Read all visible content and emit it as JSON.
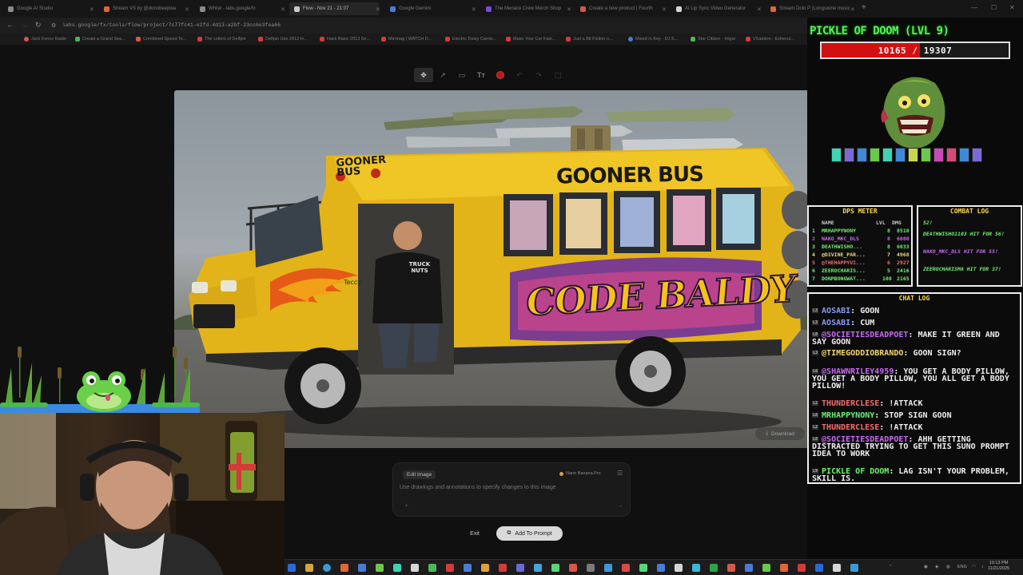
{
  "browser": {
    "tabs": [
      {
        "title": "Google AI Studio",
        "color": "#8a8a8a"
      },
      {
        "title": "Stream VS by @donobeepwa",
        "color": "#e0653a"
      },
      {
        "title": "Whisk - labs.google/fx",
        "color": "#8a8a8a"
      },
      {
        "title": "Flow - Nov 21 - 21:07",
        "color": "#6a6a6a",
        "active": true
      },
      {
        "title": "Google Gemini",
        "color": "#4a7cd6"
      },
      {
        "title": "The Menace Crew Merch Shop",
        "color": "#7a4ad6"
      },
      {
        "title": "Create a new product | Fourth",
        "color": "#d6584a"
      },
      {
        "title": "AI Lip Sync Video Generator",
        "color": "#d6d6d6"
      },
      {
        "title": "Stream Dolo P (Longswine music",
        "color": "#e0653a"
      }
    ],
    "url": "labs.google/fx/tools/flow/project/7c77fc41-e2fd-4d13-a2bf-23cc6e3fea66",
    "bookmarks": [
      {
        "label": "Jack Fence Radio",
        "color": "#d6584a"
      },
      {
        "label": "Create a Grand Sea...",
        "color": "#4ab85a"
      },
      {
        "label": "Combined Speed Te...",
        "color": "#d6584a"
      },
      {
        "label": "The coilers of Delfpin",
        "color": "#d63a3a"
      },
      {
        "label": "Delfpin Use 2013 H...",
        "color": "#d63a3a"
      },
      {
        "label": "Hack Basic 2013 Se...",
        "color": "#d63a3a"
      },
      {
        "label": "Mirrmag | WATCH D...",
        "color": "#d63a3a"
      },
      {
        "label": "Electric Daisy Carniv...",
        "color": "#d63a3a"
      },
      {
        "label": "Make Your Car Fast...",
        "color": "#d63a3a"
      },
      {
        "label": "Just a Bit Fiction o...",
        "color": "#d63a3a"
      },
      {
        "label": "Mixed In Key - DJ S...",
        "color": "#4a7cd6"
      },
      {
        "label": "Star Citizen - Imgur",
        "color": "#4ab85a"
      },
      {
        "label": "VSaddon - Eshecut...",
        "color": "#d63a3a"
      }
    ]
  },
  "flow": {
    "image_watermark": "Teccy",
    "download_label": "Download",
    "edit_panel": {
      "title": "Edit Image",
      "model": "Nano Banana Pro",
      "placeholder": "Use drawings and annotations to specify changes to this image"
    },
    "exit_label": "Exit",
    "add_to_prompt_label": "Add To Prompt"
  },
  "bus": {
    "roof_sign": "GOONER BUS",
    "side_title": "GOONER BUS",
    "graffiti": "CODE BALDY",
    "shirt_text": "TRUCK NUTS"
  },
  "boss": {
    "name": "PICKLE OF DOOM (LVL 9)",
    "hp_current": "10165",
    "hp_max": "19307",
    "hp_fraction": 0.527,
    "palette": [
      "#3fd2b4",
      "#7a6ad6",
      "#3f8ad6",
      "#6ac84a",
      "#3fd2b4",
      "#3f8ad6",
      "#c8d84a",
      "#6ac84a",
      "#c84ab4",
      "#d64a7a",
      "#3f8ad6",
      "#7a6ad6"
    ]
  },
  "dps_meter": {
    "title": "DPS METER",
    "headers": {
      "name": "NAME",
      "lvl": "LVL",
      "dmg": "DMG"
    },
    "rows": [
      {
        "rank": "1",
        "name": "MRHAPPYNONY",
        "lvl": "8",
        "dmg": "8510",
        "color": "#6ef26e"
      },
      {
        "rank": "2",
        "name": "NAKO_MKC_DLS",
        "lvl": "8",
        "dmg": "6080",
        "color": "#c86af2"
      },
      {
        "rank": "3",
        "name": "DEATHWISHO...",
        "lvl": "8",
        "dmg": "6033",
        "color": "#6ef26e"
      },
      {
        "rank": "4",
        "name": "@DIVINE_PAR...",
        "lvl": "7",
        "dmg": "4968",
        "color": "#f2d86e"
      },
      {
        "rank": "5",
        "name": "@THEHAPPYVI...",
        "lvl": "6",
        "dmg": "2927",
        "color": "#f26e6e"
      },
      {
        "rank": "6",
        "name": "ZEEROCHARIS...",
        "lvl": "5",
        "dmg": "2416",
        "color": "#6ef26e"
      },
      {
        "rank": "7",
        "name": "DONPBONGWAT...",
        "lvl": "100",
        "dmg": "2165",
        "color": "#6ef26e"
      }
    ]
  },
  "combat_log": {
    "title": "COMBAT LOG",
    "entries": [
      {
        "text": "52!",
        "color": "#6ef26e"
      },
      {
        "text": "DEATHWISHO1103 HIT FOR 56!",
        "color": "#6ef26e"
      },
      {
        "text": "NAKO_MKC_DLS HIT FOR 55!",
        "color": "#c86af2"
      },
      {
        "text": "ZEEROCHARISMA HIT FOR 37!",
        "color": "#6ef26e"
      }
    ]
  },
  "chat": {
    "title": "CHAT LOG",
    "messages": [
      {
        "badge": "L3",
        "user": "AOSABI",
        "text": "GOON",
        "color": "#8a9af2"
      },
      {
        "badge": "L3",
        "user": "AOSABI",
        "text": "CUM",
        "color": "#8a9af2"
      },
      {
        "badge": "L8",
        "user": "@SOCIETIESDEADPOET",
        "text": "MAKE IT GREEN AND SAY GOON",
        "color": "#c86af2"
      },
      {
        "badge": "L3",
        "user": "@TIMEGODDIOBRANDO",
        "text": "GOON SIGN?",
        "color": "#f2d86e"
      },
      {
        "badge": "L6",
        "user": "@SHAWNRILEY4959",
        "text": "YOU GET A BODY PILLOW, YOU GET A BODY PILLOW, YOU ALL GET A BODY PILLOW!",
        "color": "#c86af2"
      },
      {
        "badge": "L2",
        "user": "THUNDERCLESE",
        "text": "!ATTACK",
        "color": "#f26e6e"
      },
      {
        "badge": "L8",
        "user": "MRHAPPYNONY",
        "text": "STOP SIGN GOON",
        "color": "#6ef26e"
      },
      {
        "badge": "L2",
        "user": "THUNDERCLESE",
        "text": "!ATTACK",
        "color": "#f26e6e"
      },
      {
        "badge": "L8",
        "user": "@SOCIETIESDEADPOET",
        "text": "AHH GETTING DISTRACTED TRYING TO GET THIS SUNO PROMPT IDEA TO WORK",
        "color": "#c86af2"
      },
      {
        "badge": "L9",
        "user": "PICKLE OF DOOM",
        "text": "LAG ISN'T YOUR PROBLEM, SKILL IS.",
        "color": "#6ef26e"
      }
    ]
  },
  "taskbar": {
    "lang": "ENG",
    "time": "10:13 PM",
    "date": "11/21/2025",
    "icon_colors": [
      "#2a6ad6",
      "#d6a63a",
      "#3a9ad6",
      "#e0653a",
      "#4a7cd6",
      "#6ac84a",
      "#3fd2b4",
      "#d6d6d6",
      "#4ab85a",
      "#d63a3a",
      "#4a7cd6",
      "#e0a13a",
      "#d63a3a",
      "#6a6ad6",
      "#3fa6d6",
      "#5ad67a",
      "#d6584a",
      "#7a7a7a",
      "#3a9ad6",
      "#d64a4a",
      "#5ad67a",
      "#4a7cd6",
      "#d6d6d6",
      "#3ab8d6",
      "#2aa64a",
      "#d6584a",
      "#4a7cd6",
      "#6ac84a",
      "#e0653a",
      "#d63a3a",
      "#2a6ad6",
      "#d6d6d6",
      "#3a9ad6"
    ]
  }
}
